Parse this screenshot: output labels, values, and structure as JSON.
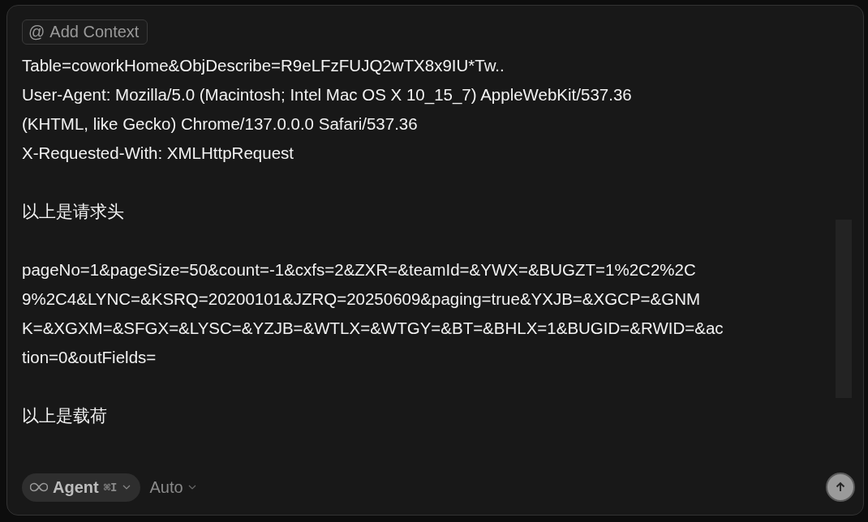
{
  "context_button": {
    "icon": "@",
    "label": "Add Context"
  },
  "message": [
    {
      "lines": [
        "Table=coworkHome&ObjDescribe=R9eLFzFUJQ2wTX8x9IU*Tw..",
        "User-Agent: Mozilla/5.0 (Macintosh; Intel Mac OS X 10_15_7) AppleWebKit/537.36",
        "(KHTML, like Gecko) Chrome/137.0.0.0 Safari/537.36",
        "X-Requested-With: XMLHttpRequest"
      ]
    },
    {
      "lines": [
        "以上是请求头"
      ]
    },
    {
      "lines": [
        "pageNo=1&pageSize=50&count=-1&cxfs=2&ZXR=&teamId=&YWX=&BUGZT=1%2C2%2C",
        "9%2C4&LYNC=&KSRQ=20200101&JZRQ=20250609&paging=true&YXJB=&XGCP=&GNM",
        "K=&XGXM=&SFGX=&LYSC=&YZJB=&WTLX=&WTGY=&BT=&BHLX=1&BUGID=&RWID=&ac",
        "tion=0&outFields="
      ]
    },
    {
      "lines": [
        "以上是载荷"
      ]
    }
  ],
  "mode_button": {
    "label": "Agent",
    "shortcut": "⌘I"
  },
  "model_select": {
    "label": "Auto"
  }
}
